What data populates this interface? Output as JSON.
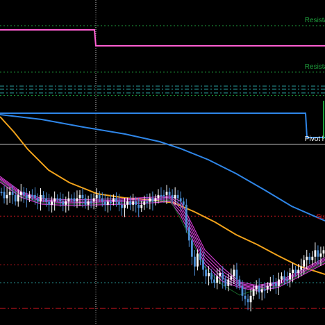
{
  "colors": {
    "background": "#000000",
    "resistance": "#1f9e3c",
    "support": "#c0141e",
    "pivot": "#ffffff",
    "bull_candle": "#ffffff",
    "bear_candle": "#4d8fd6",
    "ema_slow": "#f2a31b",
    "ma_blue": "#2f86e8",
    "step_pink": "#ff5fd2",
    "step_blue": "#2f86e8",
    "ribbon": "#e040e0",
    "dark_green": "#1a6b2c",
    "dash_cyan": "#2aa0a0"
  },
  "chart_data": {
    "type": "candlestick",
    "title": "",
    "xlabel": "",
    "ylabel": "",
    "grid": false,
    "annotations": [
      {
        "name": "resistance-1",
        "text": "Resista",
        "level_frac": 0.079,
        "color": "resistance"
      },
      {
        "name": "resistance-2",
        "text": "Resista",
        "level_frac": 0.222,
        "color": "resistance"
      },
      {
        "name": "pivot",
        "text": "Pivot l",
        "level_frac": 0.444,
        "color": "pivot"
      },
      {
        "name": "support-1",
        "text": "Supp",
        "level_frac": 0.684,
        "color": "support"
      }
    ],
    "price_levels_frac": [
      0.079,
      0.222,
      0.265,
      0.274,
      0.286,
      0.294,
      0.444,
      0.665,
      0.815,
      0.87,
      0.949
    ],
    "candles_close_frac": [
      0.59,
      0.61,
      0.6,
      0.59,
      0.6,
      0.62,
      0.6,
      0.59,
      0.6,
      0.61,
      0.6,
      0.6,
      0.61,
      0.62,
      0.6,
      0.61,
      0.62,
      0.63,
      0.62,
      0.61,
      0.61,
      0.62,
      0.63,
      0.62,
      0.61,
      0.61,
      0.62,
      0.61,
      0.6,
      0.61,
      0.63,
      0.62,
      0.62,
      0.61,
      0.6,
      0.61,
      0.62,
      0.63,
      0.62,
      0.62,
      0.61,
      0.62,
      0.63,
      0.64,
      0.63,
      0.62,
      0.63,
      0.62,
      0.63,
      0.64,
      0.63,
      0.62,
      0.62,
      0.61,
      0.62,
      0.61,
      0.6,
      0.6,
      0.6,
      0.59,
      0.6,
      0.61,
      0.6,
      0.61,
      0.62,
      0.63,
      0.7,
      0.74,
      0.79,
      0.82,
      0.78,
      0.8,
      0.83,
      0.85,
      0.84,
      0.86,
      0.87,
      0.85,
      0.84,
      0.86,
      0.88,
      0.86,
      0.85,
      0.83,
      0.86,
      0.88,
      0.91,
      0.92,
      0.93,
      0.91,
      0.89,
      0.88,
      0.9,
      0.89,
      0.89,
      0.88,
      0.87,
      0.87,
      0.88,
      0.86,
      0.85,
      0.86,
      0.86,
      0.84,
      0.83,
      0.84,
      0.83,
      0.82,
      0.8,
      0.79,
      0.8,
      0.79,
      0.77,
      0.79,
      0.78,
      0.77
    ]
  }
}
